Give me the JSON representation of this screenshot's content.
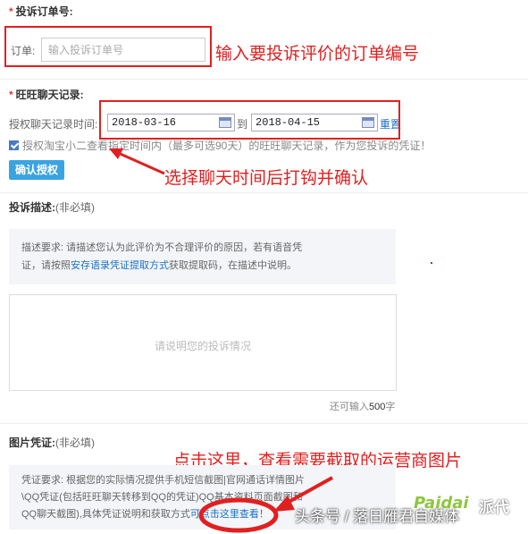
{
  "order": {
    "title": "投诉订单号:",
    "label": "订单:",
    "placeholder": "输入投诉订单号"
  },
  "chat": {
    "title": "旺旺聊天记录:",
    "label": "授权聊天记录时间:",
    "start_date": "2018-03-16",
    "to": "到",
    "end_date": "2018-04-15",
    "reset": "重置",
    "auth_text": "授权淘宝小二查看指定时间内（最多可选90天）的旺旺聊天记录，作为您投诉的凭证！",
    "confirm": "确认授权"
  },
  "description": {
    "title": "投诉描述:",
    "optional": "(非必填)",
    "req_line1": "描述要求: 请描述您认为此评价为不合理评价的原因，若有语音凭",
    "req_line2_a": "证，请按照",
    "req_link": "安存语录凭证提取方式",
    "req_line2_b": "获取提取码，在描述中说明。",
    "placeholder": "请说明您的投诉情况",
    "counter_prefix": "还可输入",
    "counter_value": "500",
    "counter_suffix": "字"
  },
  "evidence": {
    "title": "图片凭证:",
    "optional": "(非必填)",
    "req_line1": "凭证要求: 根据您的实际情况提供手机短信截图|官网通话详情图片",
    "req_line2": "\\QQ凭证(包括旺旺聊天转移到QQ的凭证)QQ基本资料页面截图和",
    "req_line3_a": "QQ聊天截图),具体凭证说明和获取方式",
    "req_link": "可点击这里查看",
    "req_line3_b": "！"
  },
  "annotations": {
    "order": "输入要投诉评价的订单编号",
    "chat": "选择聊天时间后打钩并确认",
    "evidence": "点击这里，查看需要截取的运营商图片",
    "color": "#e02020"
  },
  "watermark": {
    "text": "头条号 / 落日雁君自媒体",
    "logo": "Paidai",
    "logo_cn": "派代"
  }
}
